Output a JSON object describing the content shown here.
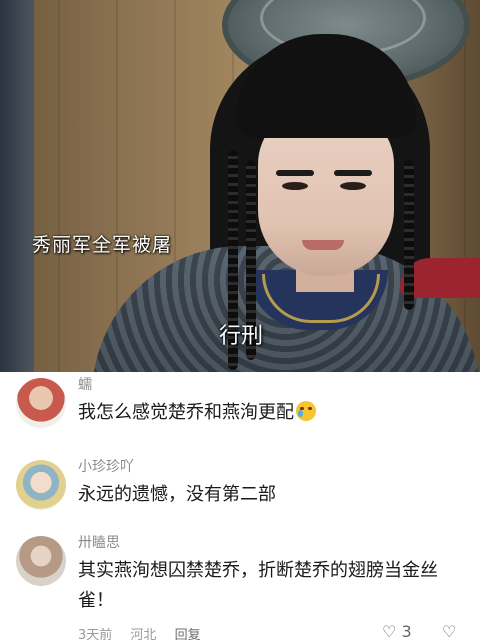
{
  "video": {
    "caption_left": "秀丽军全军被屠",
    "caption_center": "行刑"
  },
  "comments": [
    {
      "username": "蠕",
      "text": "我怎么感觉楚乔和燕洵更配",
      "emoji": "crying-laughing-icon"
    },
    {
      "username": "小珍珍吖",
      "text": "永远的遗憾，没有第二部"
    },
    {
      "username": "卅瞌思",
      "text": "其实燕洵想囚禁楚乔，折断楚乔的翅膀当金丝雀！",
      "time": "3天前",
      "location": "河北",
      "reply_label": "回复",
      "like_count": "3"
    }
  ],
  "colors": {
    "username": "#8c8c8c",
    "text": "#1a1a1a",
    "meta": "#9a9a9a"
  }
}
